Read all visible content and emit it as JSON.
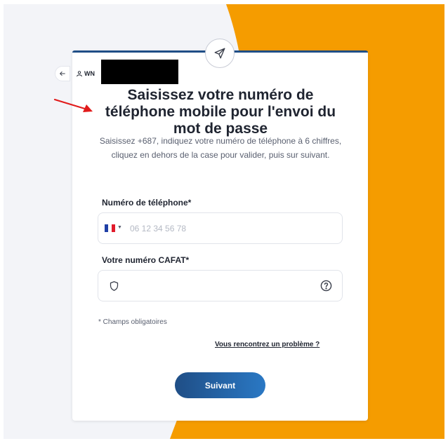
{
  "colors": {
    "accent_orange": "#f59c00",
    "primary_blue": "#1f4e86",
    "button_gradient_end": "#2a78c4",
    "annotation_red": "#e11b1b"
  },
  "icons": {
    "back": "arrow-left-icon",
    "user": "user-icon",
    "send": "send-icon",
    "shield": "shield-icon",
    "help": "help-circle-icon",
    "flag": "france-flag-icon",
    "caret": "chevron-down-icon"
  },
  "header": {
    "user_label": "WN"
  },
  "form": {
    "title": "Saisissez votre numéro de téléphone mobile pour l'envoi du mot de passe",
    "subtitle": "Saisissez +687, indiquez votre numéro de téléphone à 6 chiffres, cliquez en dehors de la case pour valider, puis sur suivant.",
    "phone": {
      "label": "Numéro de téléphone*",
      "placeholder": "06 12 34 56 78",
      "value": ""
    },
    "cafat": {
      "label": "Votre numéro CAFAT*",
      "value": ""
    },
    "required_note": "* Champs obligatoires",
    "problem_link": "Vous rencontrez un problème ?",
    "submit_label": "Suivant"
  }
}
